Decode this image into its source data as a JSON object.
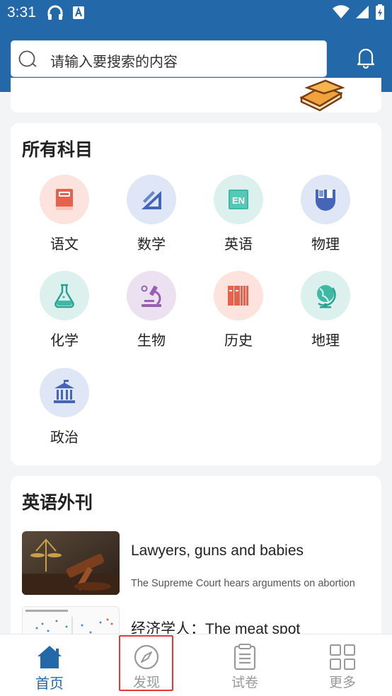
{
  "status_bar": {
    "time": "3:31"
  },
  "search": {
    "placeholder": "请输入要搜索的内容"
  },
  "subjects": {
    "title": "所有科目",
    "items": [
      {
        "label": "语文",
        "icon": "chinese-book-icon",
        "bg": "#fde3dd"
      },
      {
        "label": "数学",
        "icon": "math-ruler-icon",
        "bg": "#dfe6f5"
      },
      {
        "label": "英语",
        "icon": "english-en-icon",
        "bg": "#dcf1ee"
      },
      {
        "label": "物理",
        "icon": "physics-magnet-icon",
        "bg": "#dfe6f5"
      },
      {
        "label": "化学",
        "icon": "chemistry-flask-icon",
        "bg": "#dcf1ee"
      },
      {
        "label": "生物",
        "icon": "biology-microscope-icon",
        "bg": "#ece1f1"
      },
      {
        "label": "历史",
        "icon": "history-books-icon",
        "bg": "#fde3dd"
      },
      {
        "label": "地理",
        "icon": "geography-globe-icon",
        "bg": "#dcf1ee"
      },
      {
        "label": "政治",
        "icon": "politics-building-icon",
        "bg": "#dfe6f5"
      }
    ]
  },
  "journals": {
    "title": "英语外刊",
    "articles": [
      {
        "title": "Lawyers, guns and babies",
        "desc": "The Supreme Court hears arguments on abortion"
      },
      {
        "title": "经济学人：The meat spot",
        "desc": ""
      }
    ]
  },
  "nav": {
    "items": [
      {
        "label": "首页"
      },
      {
        "label": "发现"
      },
      {
        "label": "试卷"
      },
      {
        "label": "更多"
      }
    ]
  },
  "colors": {
    "primary": "#2368a9",
    "highlight": "#e53935"
  }
}
